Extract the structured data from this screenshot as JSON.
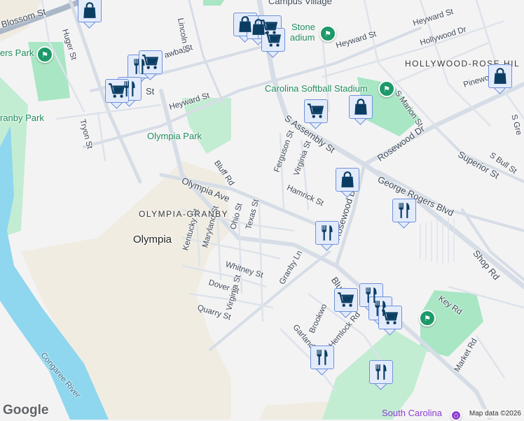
{
  "streets": {
    "blossom": "Blossom St",
    "huger": "Huger St",
    "lincoln": "Lincoln St",
    "catawba": "awba St",
    "st_fragment": "St",
    "heyward_w": "Heyward St",
    "tryon": "Tryon St",
    "bluff_rd": "Bluff Rd",
    "olympia_ave": "Olympia Ave",
    "kentucky": "Kentucky St",
    "maryland": "Maryland St",
    "ohio": "Ohio St",
    "texas": "Texas St",
    "whitney": "Whitney St",
    "dover": "Dover St",
    "quarry": "Quarry St",
    "virginia_s": "Virginia St",
    "heyward_c": "Heyward St",
    "heyward_e": "Heyward St",
    "hollywood": "Hollywood Dr",
    "s_marion": "S Marion St",
    "pinewood": "Pinewo",
    "s_assembly": "S Assembly St",
    "ferguson": "Ferguson St",
    "virginia_n": "Virginia St",
    "hamrick": "Hamrick St",
    "rosewood_dr": "Rosewood Dr",
    "rosewood_dr2": "Rosewood Dr",
    "superior": "Superior St",
    "s_bull": "S Bull St",
    "s_gregg": "S Gre",
    "george_rogers": "George Rogers Blvd",
    "shop_rd": "Shop Rd",
    "granby_ln": "Granby Ln",
    "bluff_e": "Bluff",
    "brookwood": "Brookwo",
    "hemlock": "Hemlock Rd",
    "garland": "Garland St",
    "key_rd": "Key Rd",
    "market_rd": "Market Rd"
  },
  "places": {
    "rogers_park": "ers Park",
    "granby_park": "ranby Park",
    "olympia_park": "Olympia Park",
    "campus_village": "Campus Village",
    "stone_stadium": "Stone\nadium",
    "stone_l1": "Stone",
    "stone_l2": "adium",
    "softball": "Carolina Softball Stadium",
    "hollywood_rose_hill": "HOLLYWOOD-ROSE HIL",
    "olympia_granby": "OLYMPIA-GRANBY",
    "olympia": "Olympia",
    "congaree": "Congaree River",
    "south_carolina": "South Carolina"
  },
  "footer": {
    "logo": "Google",
    "attribution": "Map data ©2026"
  },
  "markers": [
    "shopping-bag",
    "shopping-bag",
    "shopping-bag",
    "shopping-cart",
    "shopping-cart",
    "restaurant",
    "shopping-cart",
    "restaurant",
    "shopping-cart",
    "shopping-cart",
    "shopping-bag",
    "shopping-bag",
    "shopping-bag",
    "restaurant",
    "restaurant",
    "shopping-cart",
    "restaurant",
    "restaurant",
    "shopping-cart",
    "restaurant",
    "restaurant"
  ],
  "colors": {
    "marker_icon": "#0b3d63",
    "marker_bg": "#e3ebfb",
    "marker_border": "#6e91d8",
    "park": "#a8e6c4",
    "water": "#8fd6ef",
    "road": "#d6dde6",
    "poi": "#1e9a6a"
  }
}
